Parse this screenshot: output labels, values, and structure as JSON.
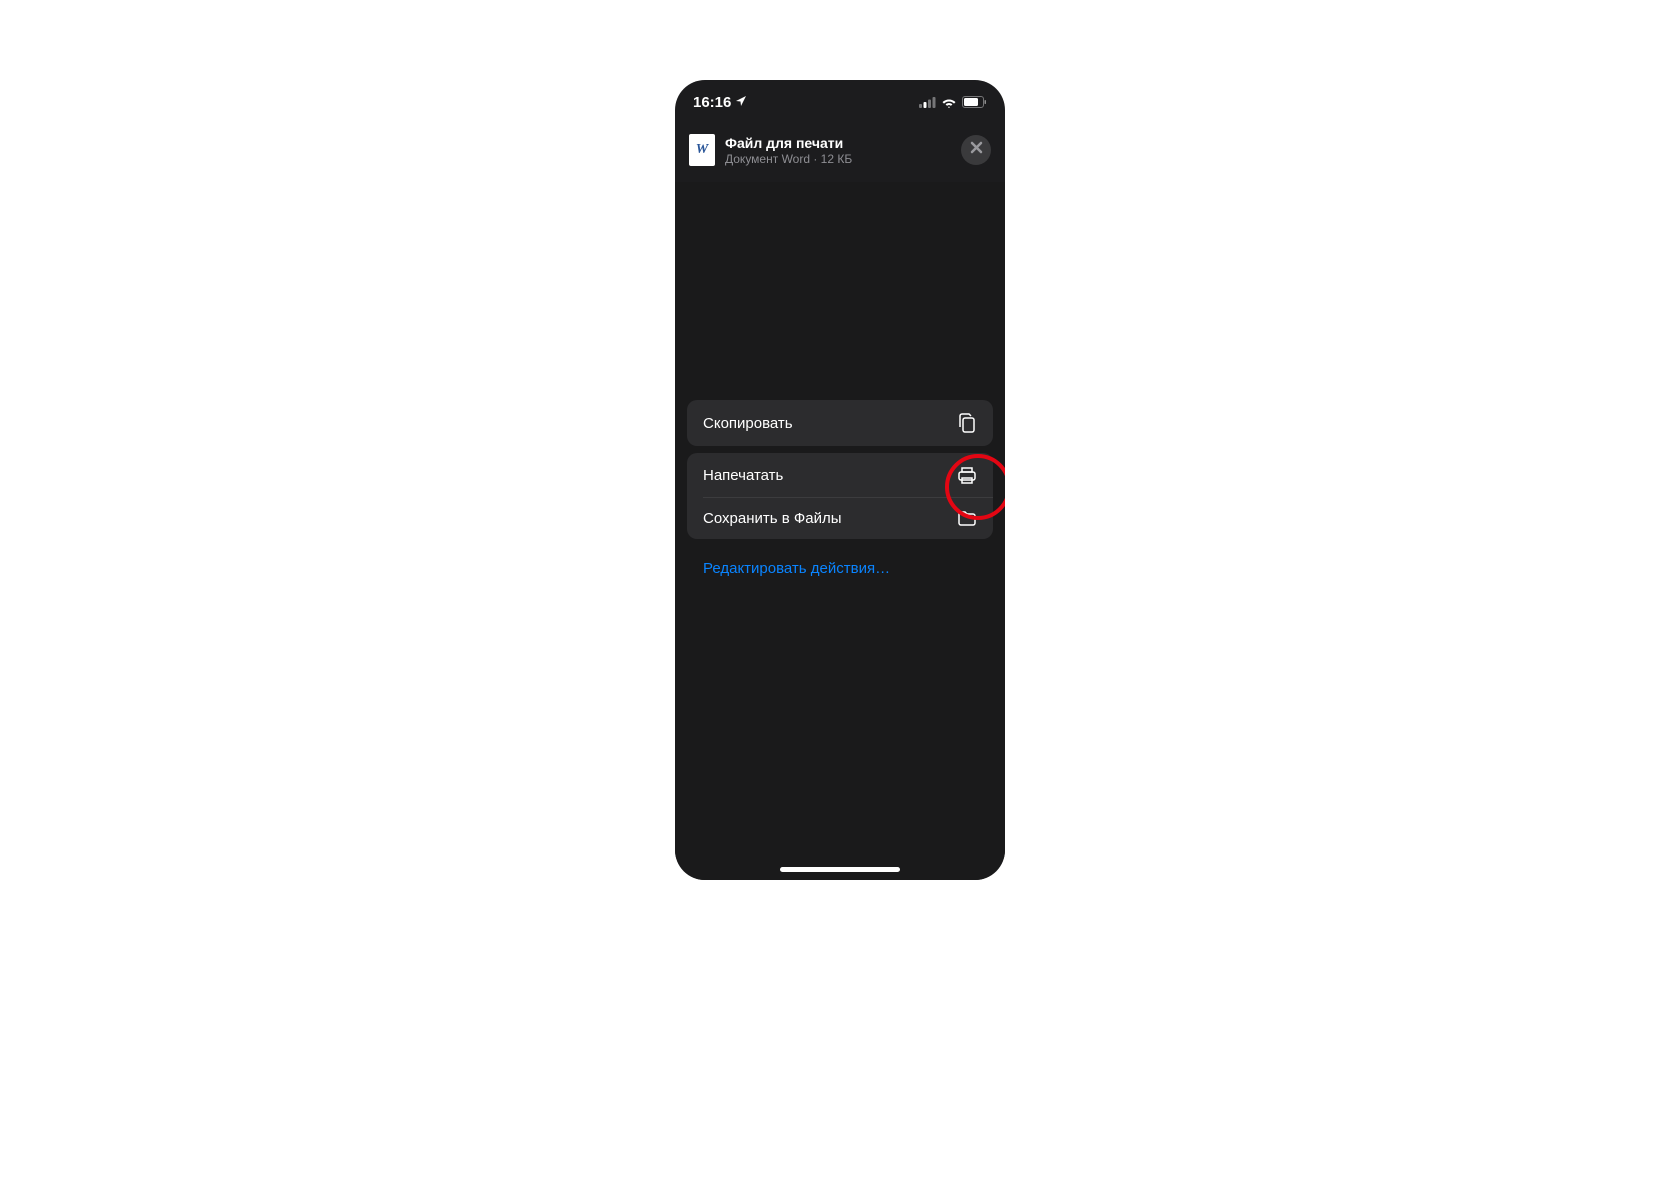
{
  "status_bar": {
    "time": "16:16",
    "location_active": true
  },
  "file": {
    "icon_letter": "W",
    "title": "Файл для печати",
    "subtitle": "Документ Word · 12 КБ"
  },
  "actions": {
    "copy": "Скопировать",
    "print": "Напечатать",
    "save_to_files": "Сохранить в Файлы",
    "edit_actions": "Редактировать действия…"
  }
}
